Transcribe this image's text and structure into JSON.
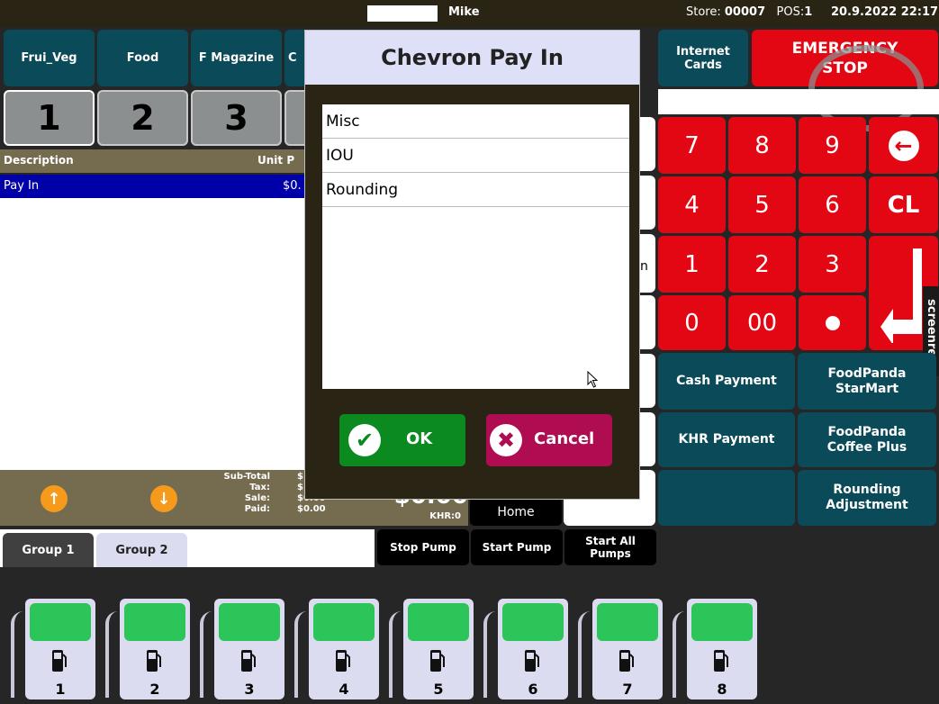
{
  "topbar": {
    "user": "Mike",
    "store_label": "Store:",
    "store_value": "00007",
    "pos_label": "POS:",
    "pos_value": "1",
    "datetime": "20.9.2022 22:17"
  },
  "categories": [
    "Frui_Veg",
    "Food",
    "F Magazine"
  ],
  "category_partial": "C",
  "right_top": {
    "internet_cards": "Internet Cards",
    "emergency": "EMERGENCY STOP"
  },
  "tabs": [
    "1",
    "2",
    "3"
  ],
  "grid": {
    "col_description": "Description",
    "col_unit": "Unit P",
    "rows": [
      {
        "description": "Pay In",
        "unit": "$0."
      }
    ]
  },
  "totals": {
    "labels": [
      "Sub-Total",
      "Tax:",
      "Sale:",
      "Paid:"
    ],
    "left_values": [
      "$",
      "$",
      "$0.00",
      "$0.00"
    ],
    "big_amount": "$0.00",
    "khr": "KHR:0"
  },
  "actions": {
    "home": "Home",
    "stop_pump": "Stop Pump",
    "start_pump": "Start Pump",
    "start_all": "Start All Pumps"
  },
  "groups": [
    "Group 1",
    "Group 2"
  ],
  "pumps": [
    "1",
    "2",
    "3",
    "4",
    "5",
    "6",
    "7",
    "8"
  ],
  "keypad": {
    "k7": "7",
    "k8": "8",
    "k9": "9",
    "k4": "4",
    "k5": "5",
    "k6": "6",
    "clear": "CL",
    "k1": "1",
    "k2": "2",
    "k3": "3",
    "k0": "0",
    "k00": "00"
  },
  "payments": {
    "cash": "Cash Payment",
    "foodpanda_starmart": "FoodPanda StarMart",
    "khr": "KHR Payment",
    "foodpanda_coffee": "FoodPanda Coffee Plus",
    "rounding": "Rounding Adjustment"
  },
  "dialog": {
    "title": "Chevron Pay In",
    "items": [
      "Misc",
      "IOU",
      "Rounding"
    ],
    "ok": "OK",
    "cancel": "Cancel"
  },
  "middle_partial": "n",
  "watermark": "screenrec",
  "colors": {
    "red_key": "#e30613",
    "teal": "#0b4a58",
    "ok_green": "#0a8a1f",
    "cancel_magenta": "#b00c52",
    "selected_row": "#0000a8",
    "pump_screen": "#2cc55a"
  }
}
